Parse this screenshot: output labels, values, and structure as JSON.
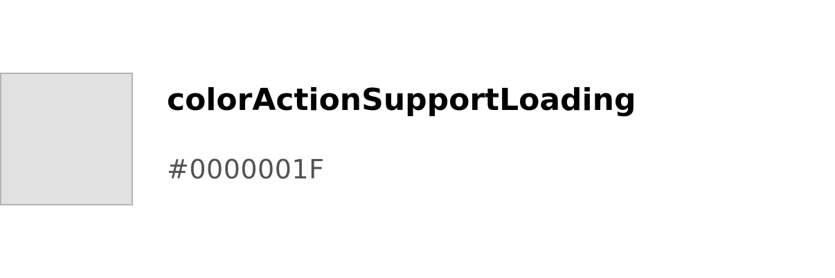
{
  "token": {
    "name": "colorActionSupportLoading",
    "value": "#0000001F"
  },
  "colors": {
    "swatch_fill": "#e1e1e1",
    "swatch_border": "#b4b4b4",
    "name_text": "#000000",
    "value_text": "#525252"
  }
}
